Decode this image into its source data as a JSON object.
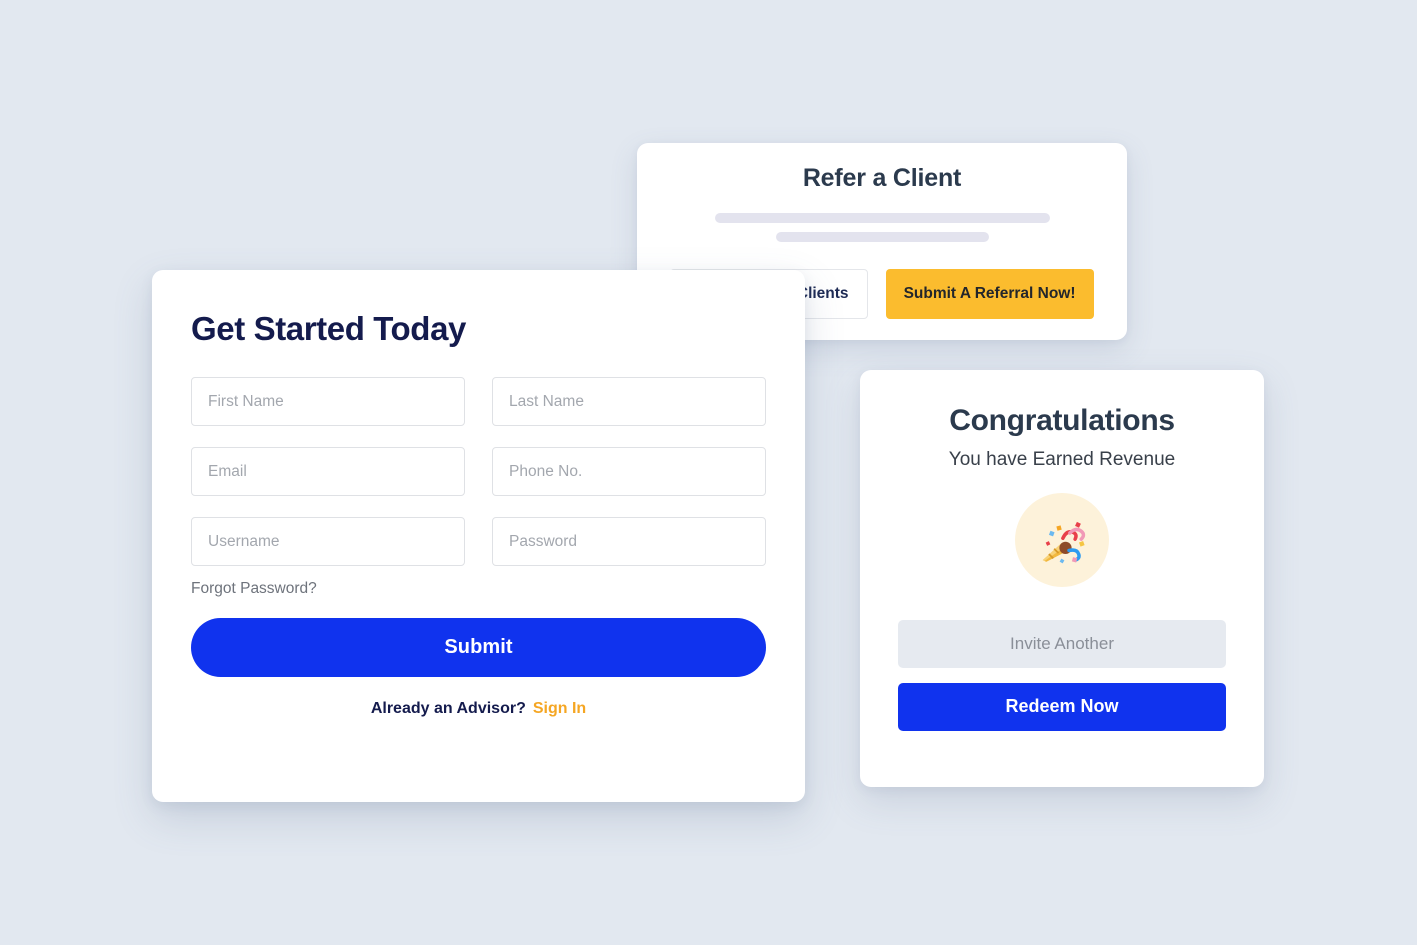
{
  "theme": {
    "page_background": "#e2e8f0",
    "primary_blue": "#1033ee",
    "accent_yellow": "#fbbc2e",
    "link_orange": "#f5a623",
    "navy_heading": "#141b4d",
    "slate_heading": "#2b3a4d",
    "skeleton_gray": "#e3e3ee",
    "badge_cream": "#fdf2da"
  },
  "refer_card": {
    "title": "Refer a Client",
    "skeleton_lines": 2,
    "view_button_label": "View Referred Clients",
    "submit_button_label": "Submit A Referral Now!"
  },
  "form_card": {
    "title": "Get Started Today",
    "fields": [
      {
        "name": "first-name",
        "placeholder": "First Name",
        "value": "",
        "type": "text"
      },
      {
        "name": "last-name",
        "placeholder": "Last Name",
        "value": "",
        "type": "text"
      },
      {
        "name": "email",
        "placeholder": "Email",
        "value": "",
        "type": "text"
      },
      {
        "name": "phone",
        "placeholder": "Phone No.",
        "value": "",
        "type": "text"
      },
      {
        "name": "username",
        "placeholder": "Username",
        "value": "",
        "type": "text"
      },
      {
        "name": "password",
        "placeholder": "Password",
        "value": "",
        "type": "password"
      }
    ],
    "forgot_password_label": "Forgot Password?",
    "submit_label": "Submit",
    "signin_prompt": "Already an Advisor?",
    "signin_link_label": "Sign In"
  },
  "congrats_card": {
    "title": "Congratulations",
    "subtitle": "You have Earned Revenue",
    "emoji_name": "party-popper-icon",
    "invite_label": "Invite Another",
    "redeem_label": "Redeem Now"
  }
}
